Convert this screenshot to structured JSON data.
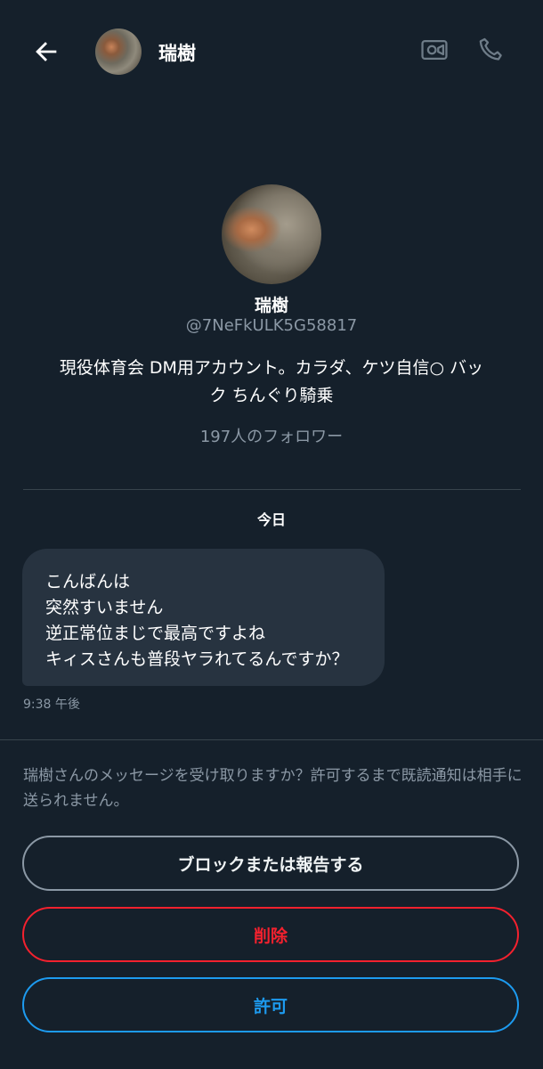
{
  "header": {
    "name": "瑞樹",
    "back_icon": "arrow-left-icon",
    "video_icon": "video-camera-icon",
    "phone_icon": "phone-icon"
  },
  "profile": {
    "name": "瑞樹",
    "handle": "@7NeFkULK5G58817",
    "bio_lines": [
      "現役体育会 DM用アカウント。カラダ、ケツ自信○ バッ",
      "ク ちんぐり騎乗"
    ],
    "followers": "197人のフォロワー"
  },
  "conversation": {
    "date_label": "今日",
    "message_lines": [
      "こんばんは",
      "突然すいません",
      "逆正常位まじで最高ですよね",
      "キィスさんも普段ヤラれてるんですか？"
    ],
    "time": "9:38 午後"
  },
  "request": {
    "text": "瑞樹さんのメッセージを受け取りますか？許可するまで既読通知は相手に送られません。",
    "block_label": "ブロックまたは報告する",
    "delete_label": "削除",
    "allow_label": "許可"
  },
  "colors": {
    "background": "#15202b",
    "bubble": "#273340",
    "muted_text": "#8b98a5",
    "danger": "#f4212e",
    "accent": "#1d9bf0"
  }
}
